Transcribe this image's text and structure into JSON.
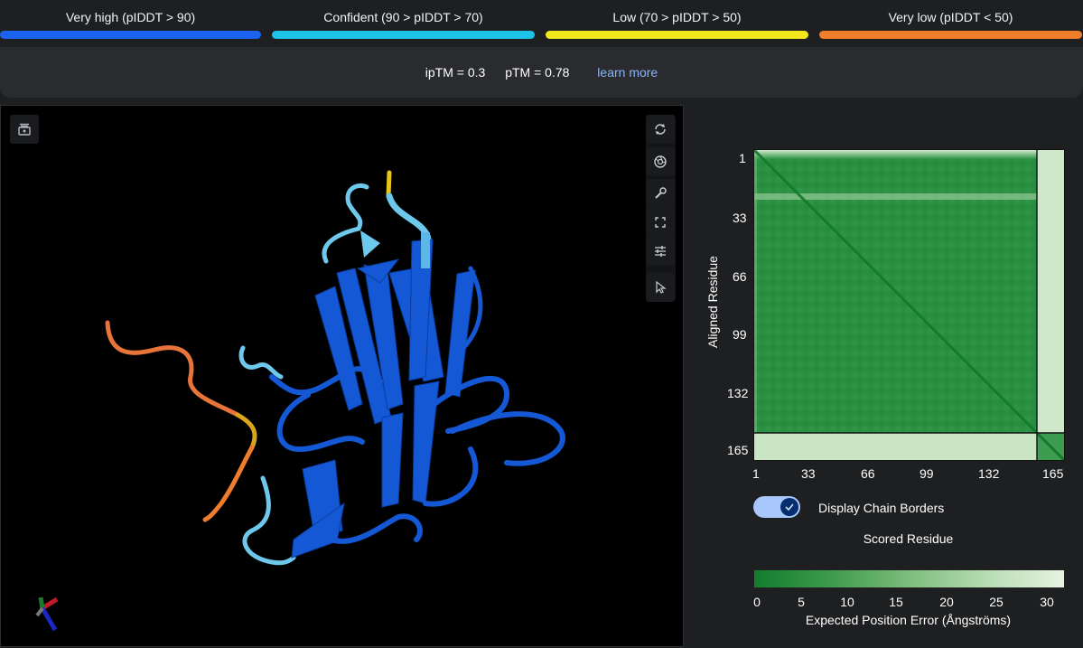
{
  "legend": {
    "items": [
      {
        "label": "Very high (pIDDT > 90)",
        "color": "#1a62f0"
      },
      {
        "label": "Confident (90 > pIDDT > 70)",
        "color": "#1ec3e8"
      },
      {
        "label": "Low (70 > pIDDT > 50)",
        "color": "#f2e61d"
      },
      {
        "label": "Very low (pIDDT < 50)",
        "color": "#f07d2b"
      }
    ]
  },
  "metrics": {
    "iptm": "ipTM = 0.3",
    "ptm": "pTM = 0.78",
    "learn_more": "learn more"
  },
  "viewer": {
    "left_tool_icon": "snapshot-icon",
    "tools": [
      "rotate-icon",
      "camera-aperture-icon",
      "wrench-icon",
      "fullscreen-icon",
      "tune-icon",
      "cursor-icon"
    ],
    "axes_icon": "xyz-axes-icon"
  },
  "pae": {
    "y_axis_title": "Aligned Residue",
    "y_ticks": [
      "1",
      "33",
      "66",
      "99",
      "132",
      "165"
    ],
    "x_ticks": [
      "1",
      "33",
      "66",
      "99",
      "132",
      "165"
    ],
    "toggle_label": "Display Chain Borders",
    "toggle_on": true,
    "x_axis_title": "Scored Residue",
    "scale_ticks": [
      "0",
      "5",
      "10",
      "15",
      "20",
      "25",
      "30"
    ],
    "scale_title": "Expected Position Error (Ångströms)"
  }
}
